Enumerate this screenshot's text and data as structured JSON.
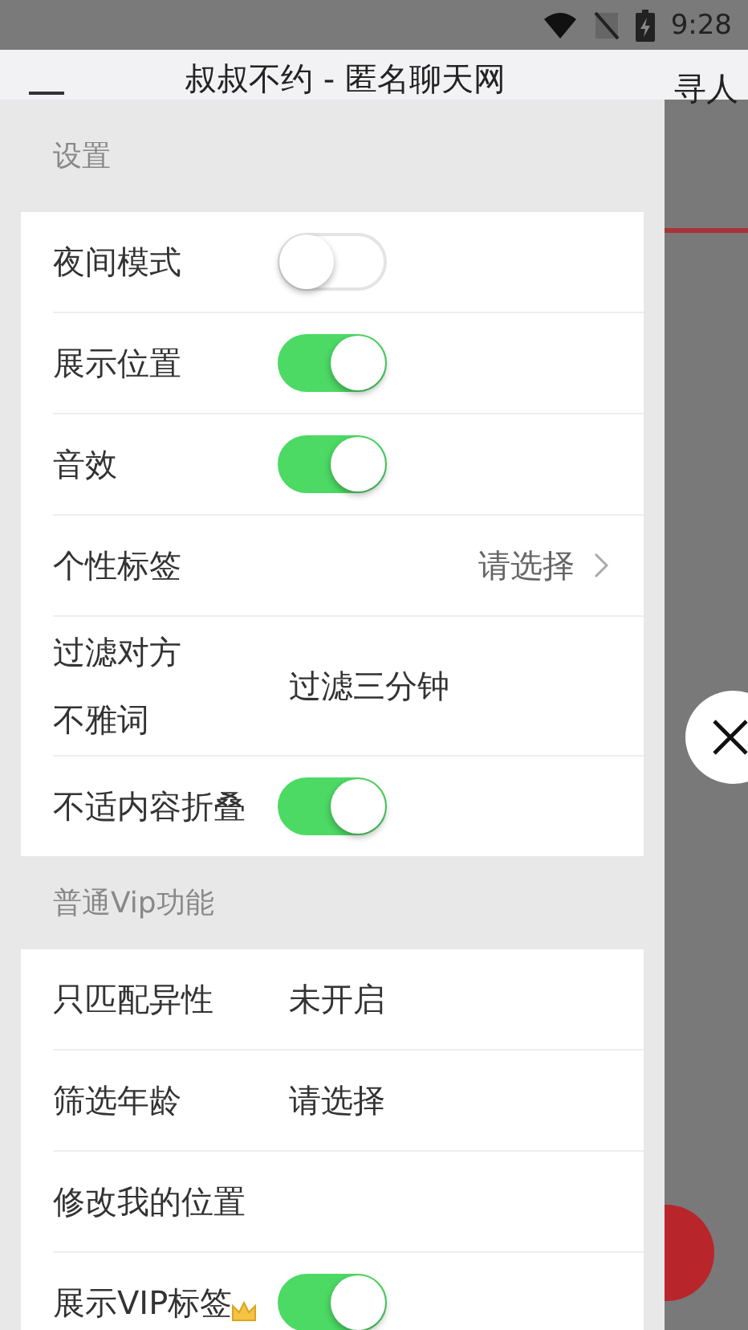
{
  "status_bar": {
    "time": "9:28"
  },
  "header": {
    "title": "叔叔不约 - 匿名聊天网",
    "action": "寻人"
  },
  "drawer": {
    "sections": [
      {
        "title": "设置",
        "rows": [
          {
            "kind": "toggle",
            "label": "夜间模式",
            "on": false
          },
          {
            "kind": "toggle",
            "label": "展示位置",
            "on": true
          },
          {
            "kind": "toggle",
            "label": "音效",
            "on": true
          },
          {
            "kind": "select",
            "label": "个性标签",
            "value": "请选择"
          },
          {
            "kind": "value",
            "label": "过滤对方不雅词",
            "value": "过滤三分钟",
            "wrap": true
          },
          {
            "kind": "toggle",
            "label": "不适内容折叠",
            "on": true
          }
        ]
      },
      {
        "title": "普通Vip功能",
        "rows": [
          {
            "kind": "value",
            "label": "只匹配异性",
            "value": "未开启"
          },
          {
            "kind": "value",
            "label": "筛选年龄",
            "value": "请选择"
          },
          {
            "kind": "plain",
            "label": "修改我的位置"
          },
          {
            "kind": "toggle",
            "label": "展示VIP标签",
            "on": true,
            "crown": true
          }
        ]
      }
    ]
  }
}
